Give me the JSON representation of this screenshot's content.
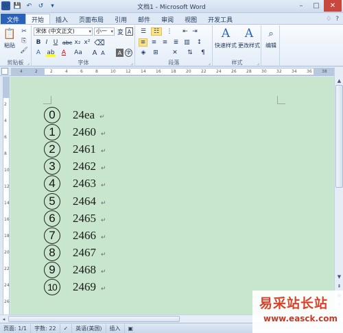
{
  "window": {
    "title": "文档1 - Microsoft Word",
    "word_logo": "W",
    "minimize": "–",
    "maximize": "□",
    "close": "✕"
  },
  "qat": {
    "save": "💾",
    "undo": "↶",
    "redo": "↺",
    "more": "▾"
  },
  "tabs": {
    "file": "文件",
    "items": [
      "开始",
      "插入",
      "页面布局",
      "引用",
      "邮件",
      "审阅",
      "视图",
      "开发工具"
    ],
    "right": [
      "♢",
      "?"
    ]
  },
  "ribbon": {
    "clipboard": {
      "label": "剪贴板",
      "paste": "粘贴"
    },
    "font": {
      "label": "字体",
      "font_name": "宋体 (中文正文)",
      "font_size": "小一",
      "bold": "B",
      "italic": "I",
      "underline": "U",
      "strike": "abc",
      "sub": "x₂",
      "sup": "x²",
      "grow": "A",
      "shrink": "A",
      "font_color": "A",
      "highlight": "ab",
      "case": "Aa",
      "phonetic": "変",
      "border": "A"
    },
    "paragraph": {
      "label": "段落"
    },
    "styles": {
      "label": "样式",
      "quick": "快速样式",
      "change": "更改样式"
    },
    "editing": {
      "label": "编辑"
    }
  },
  "ruler": {
    "ticks": [
      "4",
      "2",
      "2",
      "4",
      "6",
      "8",
      "10",
      "12",
      "14",
      "16",
      "18",
      "20",
      "22",
      "24",
      "26",
      "28",
      "30",
      "32",
      "34",
      "36",
      "38"
    ],
    "vticks": [
      "2",
      "4",
      "6",
      "8",
      "10",
      "12",
      "14",
      "16",
      "18",
      "20",
      "22",
      "24",
      "26"
    ]
  },
  "document": {
    "lines": [
      {
        "num": "0",
        "value": "24ea"
      },
      {
        "num": "1",
        "value": "2460"
      },
      {
        "num": "2",
        "value": "2461"
      },
      {
        "num": "3",
        "value": "2462"
      },
      {
        "num": "4",
        "value": "2463"
      },
      {
        "num": "5",
        "value": "2464"
      },
      {
        "num": "6",
        "value": "2465"
      },
      {
        "num": "7",
        "value": "2466"
      },
      {
        "num": "8",
        "value": "2467"
      },
      {
        "num": "9",
        "value": "2468"
      },
      {
        "num": "10",
        "value": "2469"
      }
    ],
    "para_mark": "↵",
    "background_color": "#c7e6cd"
  },
  "statusbar": {
    "page": "页面: 1/1",
    "words": "字数: 22",
    "language": "英语(美国)",
    "insert": "插入"
  },
  "watermark": {
    "title": "易采站长站",
    "url": "www.easck.com"
  }
}
